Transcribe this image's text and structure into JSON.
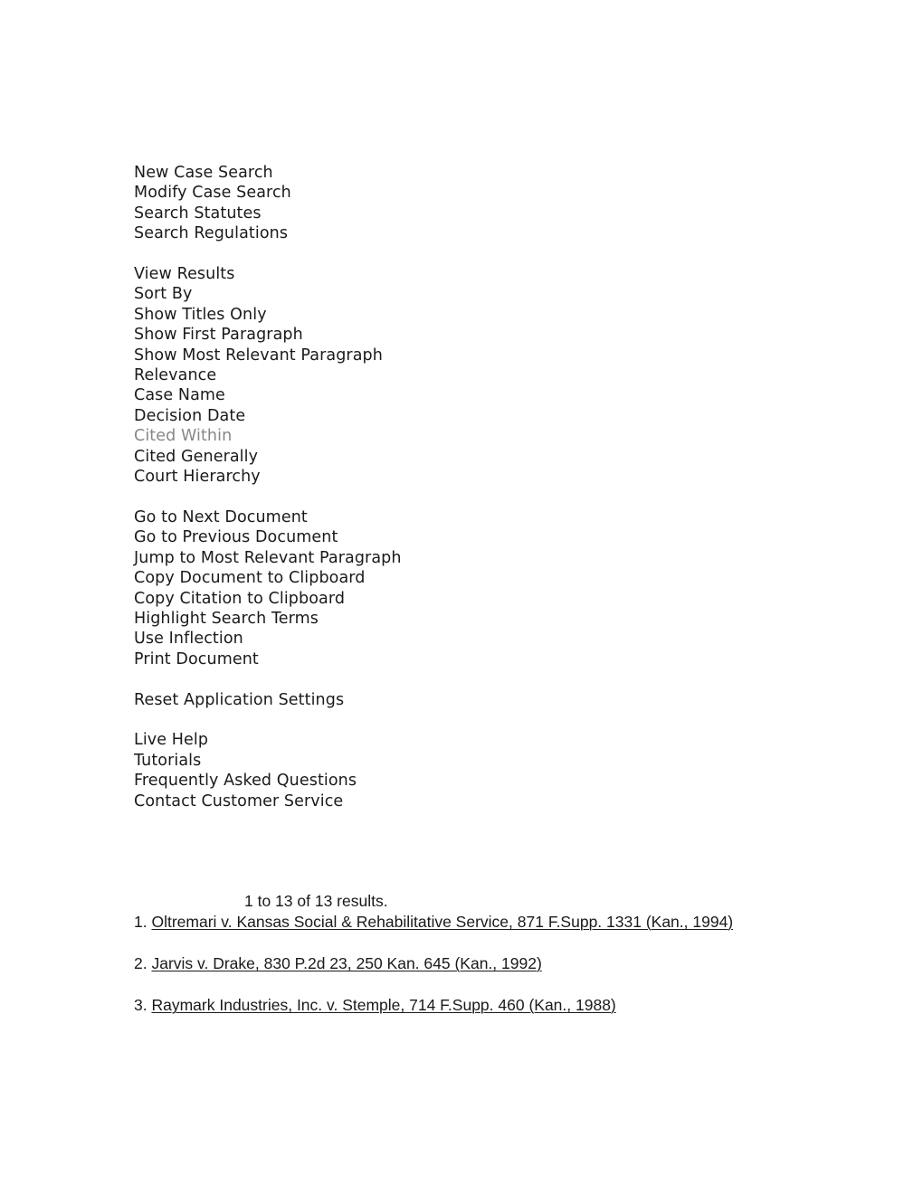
{
  "menu": {
    "groups": [
      {
        "name": "search-commands",
        "items": [
          {
            "label": "New Case Search",
            "disabled": false
          },
          {
            "label": "Modify Case Search",
            "disabled": false
          },
          {
            "label": "Search Statutes",
            "disabled": false
          },
          {
            "label": "Search Regulations",
            "disabled": false
          }
        ]
      },
      {
        "name": "results-display-commands",
        "items": [
          {
            "label": "View Results",
            "disabled": false
          },
          {
            "label": "Sort By",
            "disabled": false
          },
          {
            "label": "Show Titles Only",
            "disabled": false
          },
          {
            "label": "Show First Paragraph",
            "disabled": false
          },
          {
            "label": "Show Most Relevant Paragraph",
            "disabled": false
          },
          {
            "label": "Relevance",
            "disabled": false
          },
          {
            "label": "Case Name",
            "disabled": false
          },
          {
            "label": "Decision Date",
            "disabled": false
          },
          {
            "label": "Cited Within",
            "disabled": true
          },
          {
            "label": "Cited Generally",
            "disabled": false
          },
          {
            "label": "Court Hierarchy",
            "disabled": false
          }
        ]
      },
      {
        "name": "document-commands",
        "items": [
          {
            "label": "Go to Next Document",
            "disabled": false
          },
          {
            "label": "Go to Previous Document",
            "disabled": false
          },
          {
            "label": "Jump to Most Relevant Paragraph",
            "disabled": false
          },
          {
            "label": "Copy Document to Clipboard",
            "disabled": false
          },
          {
            "label": "Copy Citation to Clipboard",
            "disabled": false
          },
          {
            "label": "Highlight Search Terms",
            "disabled": false
          },
          {
            "label": "Use Inflection",
            "disabled": false
          },
          {
            "label": "Print Document",
            "disabled": false
          }
        ]
      },
      {
        "name": "application-commands",
        "items": [
          {
            "label": "Reset Application Settings",
            "disabled": false
          }
        ]
      },
      {
        "name": "help-commands",
        "items": [
          {
            "label": "Live Help",
            "disabled": false
          },
          {
            "label": "Tutorials",
            "disabled": false
          },
          {
            "label": "Frequently Asked Questions",
            "disabled": false
          },
          {
            "label": "Contact Customer Service",
            "disabled": false
          }
        ]
      }
    ]
  },
  "results": {
    "count_text": "1 to 13 of 13 results.",
    "items": [
      {
        "index": "1.",
        "citation": "Oltremari v. Kansas Social & Rehabilitative Service, 871 F.Supp. 1331 (Kan., 1994) "
      },
      {
        "index": "2.",
        "citation": "Jarvis v. Drake, 830 P.2d 23, 250 Kan. 645 (Kan., 1992) "
      },
      {
        "index": "3.",
        "citation": "Raymark Industries, Inc. v. Stemple, 714 F.Supp. 460 (Kan., 1988) "
      }
    ]
  },
  "colors": {
    "text": "#1a1a1a",
    "disabled_text": "#878787",
    "background": "#ffffff"
  }
}
